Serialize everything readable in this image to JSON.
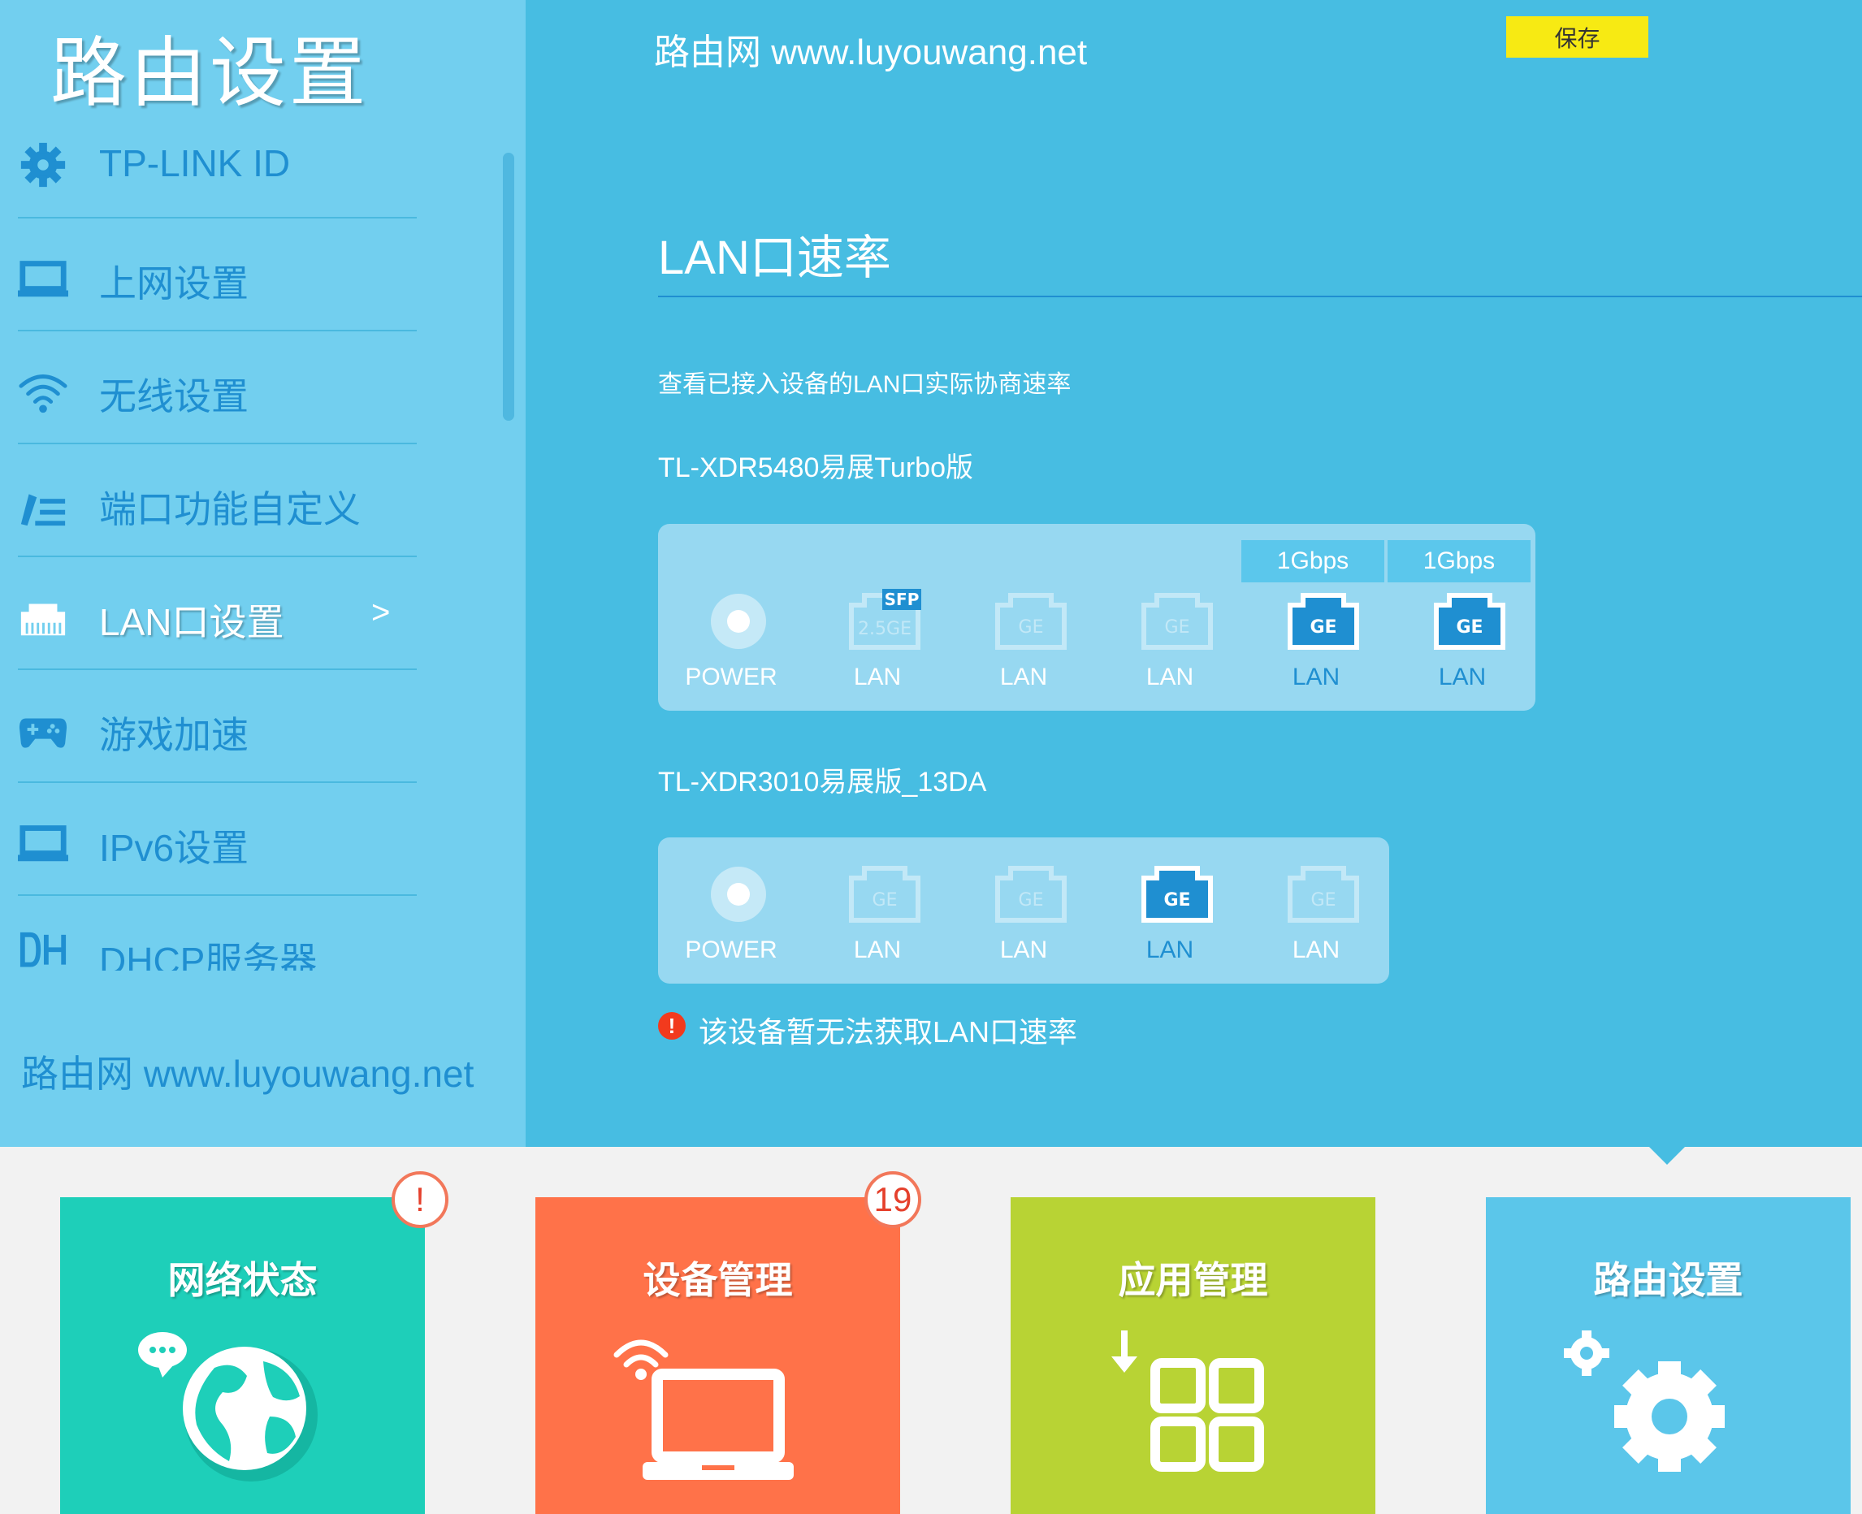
{
  "sidebar": {
    "title": "路由设置",
    "items": [
      {
        "label": "TP-LINK ID",
        "icon": "gear-icon"
      },
      {
        "label": "上网设置",
        "icon": "laptop-icon"
      },
      {
        "label": "无线设置",
        "icon": "wifi-icon"
      },
      {
        "label": "端口功能自定义",
        "icon": "edit-icon"
      },
      {
        "label": "LAN口设置",
        "icon": "lan-icon",
        "active": true,
        "chevron": ">"
      },
      {
        "label": "游戏加速",
        "icon": "gamepad-icon"
      },
      {
        "label": "IPv6设置",
        "icon": "laptop-icon"
      },
      {
        "label": "DHCP服务器",
        "icon": "dhcp-icon"
      }
    ],
    "watermark": "路由网 www.luyouwang.net"
  },
  "header": {
    "watermark": "路由网 www.luyouwang.net",
    "save_label": "保存"
  },
  "section": {
    "title": "LAN口速率",
    "description": "查看已接入设备的LAN口实际协商速率"
  },
  "devices": [
    {
      "name": "TL-XDR5480易展Turbo版",
      "ports": [
        {
          "label": "POWER",
          "type": "power"
        },
        {
          "label": "LAN",
          "type": "sfp",
          "badge": "SFP",
          "icon_text": "2.5GE",
          "active": false
        },
        {
          "label": "LAN",
          "type": "ge",
          "icon_text": "GE",
          "active": false
        },
        {
          "label": "LAN",
          "type": "ge",
          "icon_text": "GE",
          "active": false
        },
        {
          "label": "LAN",
          "type": "ge",
          "icon_text": "GE",
          "active": true,
          "speed": "1Gbps"
        },
        {
          "label": "LAN",
          "type": "ge",
          "icon_text": "GE",
          "active": true,
          "speed": "1Gbps"
        }
      ]
    },
    {
      "name": "TL-XDR3010易展版_13DA",
      "ports": [
        {
          "label": "POWER",
          "type": "power"
        },
        {
          "label": "LAN",
          "type": "ge",
          "icon_text": "GE",
          "active": false
        },
        {
          "label": "LAN",
          "type": "ge",
          "icon_text": "GE",
          "active": false
        },
        {
          "label": "LAN",
          "type": "ge",
          "icon_text": "GE",
          "active": true
        },
        {
          "label": "LAN",
          "type": "ge",
          "icon_text": "GE",
          "active": false
        }
      ],
      "warning": {
        "icon": "!",
        "text": "该设备暂无法获取LAN口速率"
      }
    }
  ],
  "tiles": [
    {
      "label": "网络状态",
      "color": "#1ecfb9",
      "icon": "globe-icon",
      "badge": "!"
    },
    {
      "label": "设备管理",
      "color": "#ff7249",
      "icon": "laptop-wifi-icon",
      "badge": "19"
    },
    {
      "label": "应用管理",
      "color": "#b8d334",
      "icon": "apps-icon"
    },
    {
      "label": "路由设置",
      "color": "#5bc6ea",
      "icon": "gears-icon",
      "active": true
    }
  ],
  "colors": {
    "accent": "#1f8fd1",
    "sidebar_bg": "#72cfef",
    "main_bg": "#47bde2",
    "save_button": "#f7ea13",
    "warning": "#f23a1d"
  }
}
